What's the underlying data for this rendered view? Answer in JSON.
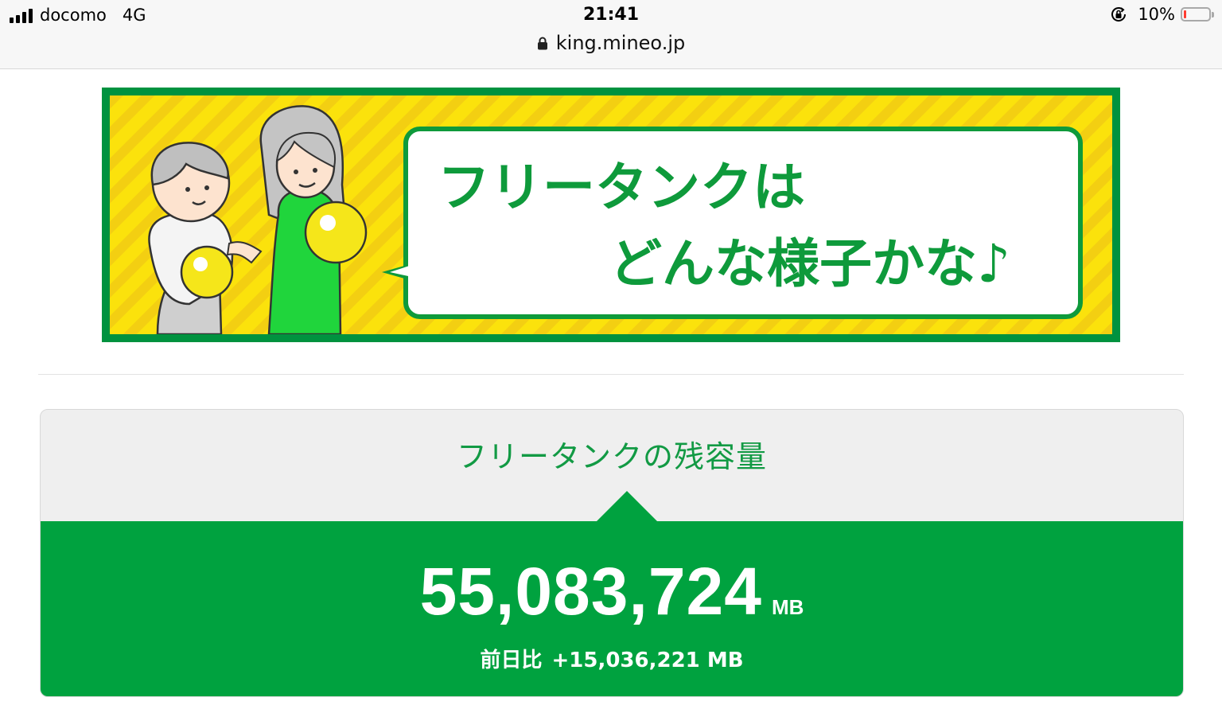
{
  "status_bar": {
    "carrier": "docomo",
    "network": "4G",
    "time": "21:41",
    "battery_percent_text": "10%",
    "battery_level": 0.1,
    "battery_color": "#ff3b30",
    "icons": [
      "signal-bars-icon",
      "rotation-lock-icon",
      "battery-icon"
    ]
  },
  "browser": {
    "url": "king.mineo.jp",
    "icons": [
      "padlock-icon"
    ]
  },
  "banner": {
    "line1": "フリータンクは",
    "line2": "どんな様子かな♪",
    "colors": {
      "border": "#00923f",
      "background": "#fbe20c",
      "text": "#0e9a3b"
    }
  },
  "card": {
    "title": "フリータンクの残容量",
    "amount": "55,083,724",
    "amount_unit": "MB",
    "diff_label": "前日比",
    "diff_value": "+15,036,221 MB",
    "colors": {
      "accent": "#00a23f",
      "header_bg": "#efefef",
      "title": "#129a44"
    }
  }
}
